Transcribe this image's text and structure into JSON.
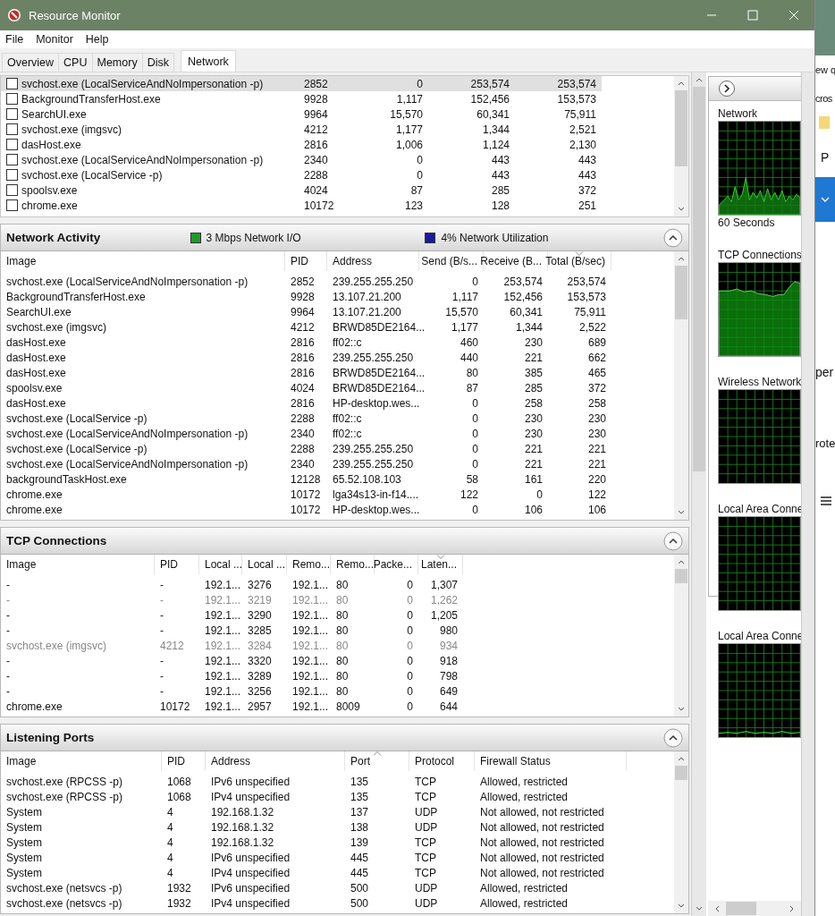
{
  "window": {
    "title": "Resource Monitor"
  },
  "menu": [
    "File",
    "Monitor",
    "Help"
  ],
  "tabs": [
    {
      "label": "Overview",
      "selected": false
    },
    {
      "label": "CPU",
      "selected": false
    },
    {
      "label": "Memory",
      "selected": false
    },
    {
      "label": "Disk",
      "selected": false
    },
    {
      "label": "Network",
      "selected": true
    }
  ],
  "process_list": {
    "rows": [
      {
        "cells": [
          "svchost.exe (LocalServiceAndNoImpersonation -p)",
          "2852",
          "0",
          "253,574",
          "253,574"
        ],
        "checked": false,
        "selected": true
      },
      {
        "cells": [
          "BackgroundTransferHost.exe",
          "9928",
          "1,117",
          "152,456",
          "153,573"
        ],
        "checked": false,
        "selected": false
      },
      {
        "cells": [
          "SearchUI.exe",
          "9964",
          "15,570",
          "60,341",
          "75,911"
        ],
        "checked": false,
        "selected": false
      },
      {
        "cells": [
          "svchost.exe (imgsvc)",
          "4212",
          "1,177",
          "1,344",
          "2,521"
        ],
        "checked": false,
        "selected": false
      },
      {
        "cells": [
          "dasHost.exe",
          "2816",
          "1,006",
          "1,124",
          "2,130"
        ],
        "checked": false,
        "selected": false
      },
      {
        "cells": [
          "svchost.exe (LocalServiceAndNoImpersonation -p)",
          "2340",
          "0",
          "443",
          "443"
        ],
        "checked": false,
        "selected": false
      },
      {
        "cells": [
          "svchost.exe (LocalService -p)",
          "2288",
          "0",
          "443",
          "443"
        ],
        "checked": false,
        "selected": false
      },
      {
        "cells": [
          "spoolsv.exe",
          "4024",
          "87",
          "285",
          "372"
        ],
        "checked": false,
        "selected": false
      },
      {
        "cells": [
          "chrome.exe",
          "10172",
          "123",
          "128",
          "251"
        ],
        "checked": false,
        "selected": false
      }
    ]
  },
  "panels": [
    {
      "title": "Network Activity",
      "expanded": true,
      "legend": [
        {
          "label": "3 Mbps Network I/O",
          "color": "#1f9a2a"
        },
        {
          "label": "4% Network Utilization",
          "color": "#1a1aa0"
        }
      ],
      "columns": [
        {
          "label": "Image",
          "sorted": false
        },
        {
          "label": "PID",
          "sorted": false
        },
        {
          "label": "Address",
          "sorted": false
        },
        {
          "label": "Send (B/s...",
          "sorted": false
        },
        {
          "label": "Receive (B...",
          "sorted": false
        },
        {
          "label": "Total (B/sec)",
          "sorted": true,
          "ascending": false
        }
      ],
      "rows": [
        {
          "cells": [
            "svchost.exe (LocalServiceAndNoImpersonation -p)",
            "2852",
            "239.255.255.250",
            "0",
            "253,574",
            "253,574"
          ],
          "dimmed": false
        },
        {
          "cells": [
            "BackgroundTransferHost.exe",
            "9928",
            "13.107.21.200",
            "1,117",
            "152,456",
            "153,573"
          ],
          "dimmed": false
        },
        {
          "cells": [
            "SearchUI.exe",
            "9964",
            "13.107.21.200",
            "15,570",
            "60,341",
            "75,911"
          ],
          "dimmed": false
        },
        {
          "cells": [
            "svchost.exe (imgsvc)",
            "4212",
            "BRWD85DE2164...",
            "1,177",
            "1,344",
            "2,522"
          ],
          "dimmed": false
        },
        {
          "cells": [
            "dasHost.exe",
            "2816",
            "ff02::c",
            "460",
            "230",
            "689"
          ],
          "dimmed": false
        },
        {
          "cells": [
            "dasHost.exe",
            "2816",
            "239.255.255.250",
            "440",
            "221",
            "662"
          ],
          "dimmed": false
        },
        {
          "cells": [
            "dasHost.exe",
            "2816",
            "BRWD85DE2164...",
            "80",
            "385",
            "465"
          ],
          "dimmed": false
        },
        {
          "cells": [
            "spoolsv.exe",
            "4024",
            "BRWD85DE2164...",
            "87",
            "285",
            "372"
          ],
          "dimmed": false
        },
        {
          "cells": [
            "dasHost.exe",
            "2816",
            "HP-desktop.wes...",
            "0",
            "258",
            "258"
          ],
          "dimmed": false
        },
        {
          "cells": [
            "svchost.exe (LocalService -p)",
            "2288",
            "ff02::c",
            "0",
            "230",
            "230"
          ],
          "dimmed": false
        },
        {
          "cells": [
            "svchost.exe (LocalServiceAndNoImpersonation -p)",
            "2340",
            "ff02::c",
            "0",
            "230",
            "230"
          ],
          "dimmed": false
        },
        {
          "cells": [
            "svchost.exe (LocalService -p)",
            "2288",
            "239.255.255.250",
            "0",
            "221",
            "221"
          ],
          "dimmed": false
        },
        {
          "cells": [
            "svchost.exe (LocalServiceAndNoImpersonation -p)",
            "2340",
            "239.255.255.250",
            "0",
            "221",
            "221"
          ],
          "dimmed": false
        },
        {
          "cells": [
            "backgroundTaskHost.exe",
            "12128",
            "65.52.108.103",
            "58",
            "161",
            "220"
          ],
          "dimmed": false
        },
        {
          "cells": [
            "chrome.exe",
            "10172",
            "lga34s13-in-f14....",
            "122",
            "0",
            "122"
          ],
          "dimmed": false
        },
        {
          "cells": [
            "chrome.exe",
            "10172",
            "HP-desktop.wes...",
            "0",
            "106",
            "106"
          ],
          "dimmed": false
        }
      ]
    },
    {
      "title": "TCP Connections",
      "expanded": true,
      "columns": [
        {
          "label": "Image",
          "sorted": false
        },
        {
          "label": "PID",
          "sorted": false
        },
        {
          "label": "Local ...",
          "sorted": false
        },
        {
          "label": "Local ...",
          "sorted": false
        },
        {
          "label": "Remo...",
          "sorted": false
        },
        {
          "label": "Remo...",
          "sorted": false
        },
        {
          "label": "Packe...",
          "sorted": false
        },
        {
          "label": "Laten...",
          "sorted": true,
          "ascending": false
        }
      ],
      "rows": [
        {
          "cells": [
            "-",
            "-",
            "192.1...",
            "3276",
            "192.1...",
            "80",
            "0",
            "1,307"
          ],
          "dimmed": false
        },
        {
          "cells": [
            "-",
            "-",
            "192.1...",
            "3219",
            "192.1...",
            "80",
            "0",
            "1,262"
          ],
          "dimmed": true
        },
        {
          "cells": [
            "-",
            "-",
            "192.1...",
            "3290",
            "192.1...",
            "80",
            "0",
            "1,205"
          ],
          "dimmed": false
        },
        {
          "cells": [
            "-",
            "-",
            "192.1...",
            "3285",
            "192.1...",
            "80",
            "0",
            "980"
          ],
          "dimmed": false
        },
        {
          "cells": [
            "svchost.exe (imgsvc)",
            "4212",
            "192.1...",
            "3284",
            "192.1...",
            "80",
            "0",
            "934"
          ],
          "dimmed": true
        },
        {
          "cells": [
            "-",
            "-",
            "192.1...",
            "3320",
            "192.1...",
            "80",
            "0",
            "918"
          ],
          "dimmed": false
        },
        {
          "cells": [
            "-",
            "-",
            "192.1...",
            "3289",
            "192.1...",
            "80",
            "0",
            "798"
          ],
          "dimmed": false
        },
        {
          "cells": [
            "-",
            "-",
            "192.1...",
            "3256",
            "192.1...",
            "80",
            "0",
            "649"
          ],
          "dimmed": false
        },
        {
          "cells": [
            "chrome.exe",
            "10172",
            "192.1...",
            "2957",
            "192.1...",
            "8009",
            "0",
            "644"
          ],
          "dimmed": false
        }
      ]
    },
    {
      "title": "Listening Ports",
      "expanded": true,
      "columns": [
        {
          "label": "Image",
          "sorted": false
        },
        {
          "label": "PID",
          "sorted": false
        },
        {
          "label": "Address",
          "sorted": false
        },
        {
          "label": "Port",
          "sorted": true,
          "ascending": true
        },
        {
          "label": "Protocol",
          "sorted": false
        },
        {
          "label": "Firewall Status",
          "sorted": false
        }
      ],
      "rows": [
        {
          "cells": [
            "svchost.exe (RPCSS -p)",
            "1068",
            "IPv6 unspecified",
            "135",
            "TCP",
            "Allowed, restricted"
          ],
          "dimmed": false
        },
        {
          "cells": [
            "svchost.exe (RPCSS -p)",
            "1068",
            "IPv4 unspecified",
            "135",
            "TCP",
            "Allowed, restricted"
          ],
          "dimmed": false
        },
        {
          "cells": [
            "System",
            "4",
            "192.168.1.32",
            "137",
            "UDP",
            "Not allowed, not restricted"
          ],
          "dimmed": false
        },
        {
          "cells": [
            "System",
            "4",
            "192.168.1.32",
            "138",
            "UDP",
            "Not allowed, not restricted"
          ],
          "dimmed": false
        },
        {
          "cells": [
            "System",
            "4",
            "192.168.1.32",
            "139",
            "TCP",
            "Not allowed, not restricted"
          ],
          "dimmed": false
        },
        {
          "cells": [
            "System",
            "4",
            "IPv6 unspecified",
            "445",
            "TCP",
            "Not allowed, not restricted"
          ],
          "dimmed": false
        },
        {
          "cells": [
            "System",
            "4",
            "IPv4 unspecified",
            "445",
            "TCP",
            "Not allowed, not restricted"
          ],
          "dimmed": false
        },
        {
          "cells": [
            "svchost.exe (netsvcs -p)",
            "1932",
            "IPv6 unspecified",
            "500",
            "UDP",
            "Allowed, restricted"
          ],
          "dimmed": false
        },
        {
          "cells": [
            "svchost.exe (netsvcs -p)",
            "1932",
            "IPv4 unspecified",
            "500",
            "UDP",
            "Allowed, restricted"
          ],
          "dimmed": false
        }
      ]
    }
  ],
  "graphs": [
    {
      "label": "Network",
      "caption": "60 Seconds",
      "kind": "spiky"
    },
    {
      "label": "TCP Connections",
      "kind": "high"
    },
    {
      "label": "Wireless Network",
      "kind": "empty"
    },
    {
      "label": "Local Area Conne",
      "kind": "empty"
    },
    {
      "label": "Local Area Conne",
      "kind": "flat"
    }
  ],
  "background_window": {
    "texts": [
      "ew q",
      "cros",
      "P",
      "per",
      "rote"
    ]
  }
}
